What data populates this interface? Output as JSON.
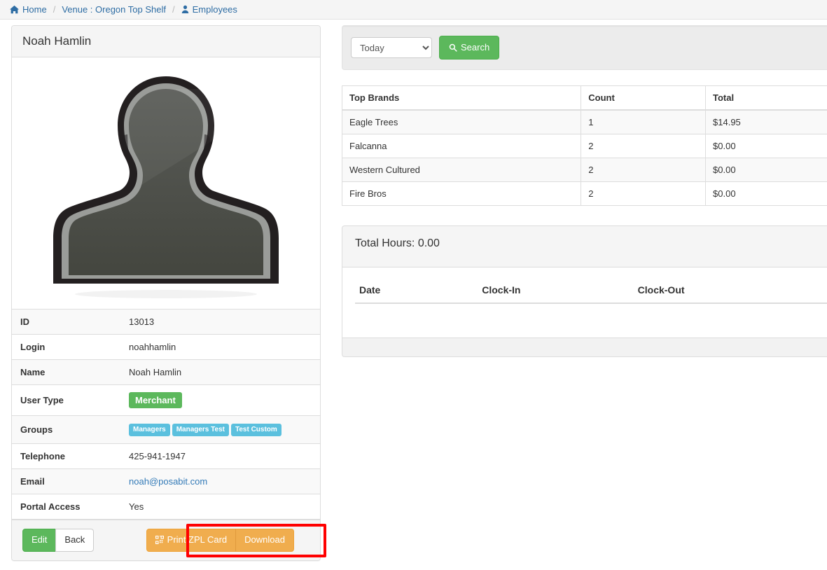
{
  "breadcrumb": {
    "items": [
      {
        "label": "Home",
        "icon": "home-icon"
      },
      {
        "label": "Venue : Oregon Top Shelf",
        "icon": null
      },
      {
        "label": "Employees",
        "icon": "user-icon"
      }
    ],
    "separator": "/"
  },
  "employee_card": {
    "title": "Noah Hamlin",
    "avatar_icon": "user-placeholder-avatar",
    "details": [
      {
        "label": "ID",
        "value": "13013",
        "type": "text"
      },
      {
        "label": "Login",
        "value": "noahhamlin",
        "type": "text"
      },
      {
        "label": "Name",
        "value": "Noah Hamlin",
        "type": "text"
      },
      {
        "label": "User Type",
        "value": "Merchant",
        "type": "badge-success"
      },
      {
        "label": "Groups",
        "value": "Managers, Managers Test, Test Custom",
        "type": "badge-info-list"
      },
      {
        "label": "Telephone",
        "value": "425-941-1947",
        "type": "text"
      },
      {
        "label": "Email",
        "value": "noah@posabit.com",
        "type": "link"
      },
      {
        "label": "Portal Access",
        "value": "Yes",
        "type": "text"
      }
    ],
    "groups": [
      "Managers",
      "Managers Test",
      "Test Custom"
    ],
    "footer": {
      "edit_label": "Edit",
      "back_label": "Back",
      "print_zpl_label": "Print ZPL Card",
      "print_zpl_icon": "qrcode-icon",
      "download_label": "Download",
      "highlight_color": "#ff0000"
    }
  },
  "search": {
    "period_selected": "Today",
    "period_options": [
      "Today"
    ],
    "search_label": "Search",
    "search_icon": "search-icon"
  },
  "top_brands": {
    "columns": [
      "Top Brands",
      "Count",
      "Total"
    ],
    "rows": [
      {
        "brand": "Eagle Trees",
        "count": "1",
        "total": "$14.95"
      },
      {
        "brand": "Falcanna",
        "count": "2",
        "total": "$0.00"
      },
      {
        "brand": "Western Cultured",
        "count": "2",
        "total": "$0.00"
      },
      {
        "brand": "Fire Bros",
        "count": "2",
        "total": "$0.00"
      }
    ]
  },
  "hours": {
    "total_hours_label": "Total Hours: 0.00",
    "columns": [
      "Date",
      "Clock-In",
      "Clock-Out"
    ],
    "rows": []
  },
  "colors": {
    "brand_green": "#5cb85c",
    "brand_orange": "#f0ad4e",
    "brand_info": "#5bc0de",
    "link_blue": "#337ab7",
    "highlight_red": "#ff0000"
  }
}
